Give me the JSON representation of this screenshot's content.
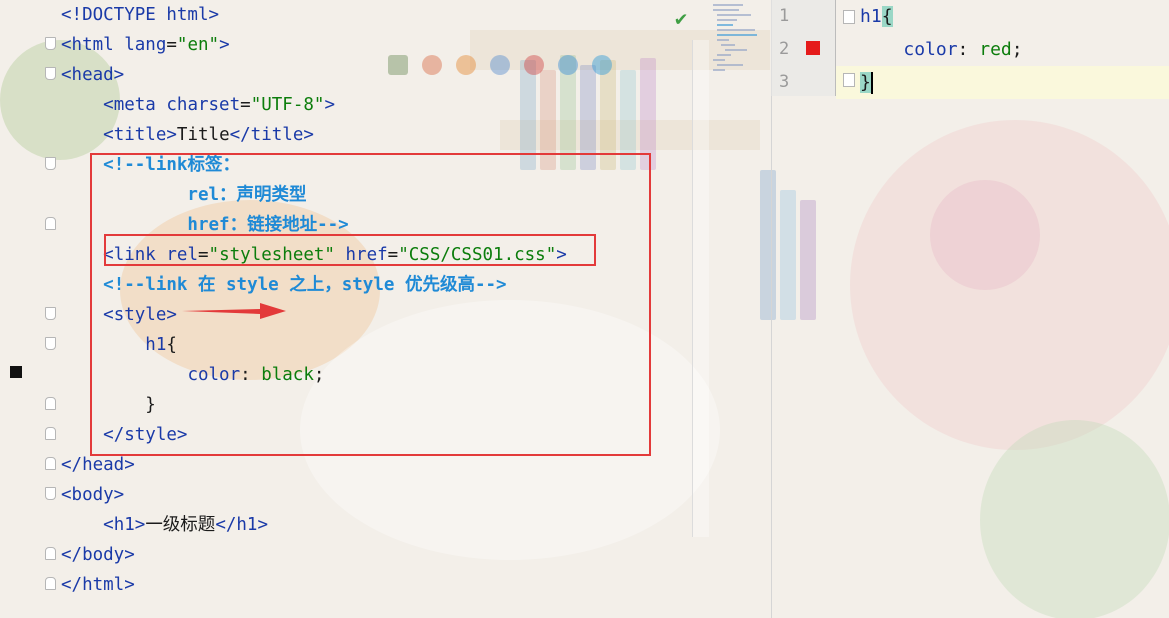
{
  "status": {
    "check_icon": "check-icon",
    "check_color": "#3f9e44"
  },
  "colors": {
    "tag": "#1a3aa8",
    "string": "#0c7d0c",
    "comment": "#1f8ad6",
    "annotation": "#e33a3a",
    "error_marker": "#e51b1b"
  },
  "left_editor": {
    "lines": [
      {
        "parts": [
          [
            "tag",
            "<!DOCTYPE html>"
          ]
        ]
      },
      {
        "parts": [
          [
            "tag",
            "<html "
          ],
          [
            "attr",
            "lang"
          ],
          [
            "punct",
            "="
          ],
          [
            "str",
            "\"en\""
          ],
          [
            "tag",
            ">"
          ]
        ]
      },
      {
        "parts": [
          [
            "tag",
            "<head>"
          ]
        ]
      },
      {
        "parts": [
          [
            "txt",
            "    "
          ],
          [
            "tag",
            "<meta "
          ],
          [
            "attr",
            "charset"
          ],
          [
            "punct",
            "="
          ],
          [
            "str",
            "\"UTF-8\""
          ],
          [
            "tag",
            ">"
          ]
        ]
      },
      {
        "parts": [
          [
            "txt",
            "    "
          ],
          [
            "tag",
            "<title>"
          ],
          [
            "txt",
            "Title"
          ],
          [
            "tag",
            "</title>"
          ]
        ]
      },
      {
        "parts": [
          [
            "txt",
            "    "
          ],
          [
            "cmt",
            "<!--link标签："
          ]
        ]
      },
      {
        "parts": [
          [
            "cmt",
            "            rel：声明类型"
          ]
        ]
      },
      {
        "parts": [
          [
            "cmt",
            "            href：链接地址-->"
          ]
        ]
      },
      {
        "parts": [
          [
            "txt",
            "    "
          ],
          [
            "tag",
            "<link "
          ],
          [
            "attr",
            "rel"
          ],
          [
            "punct",
            "="
          ],
          [
            "str",
            "\"stylesheet\""
          ],
          [
            "txt",
            " "
          ],
          [
            "attr",
            "href"
          ],
          [
            "punct",
            "="
          ],
          [
            "str",
            "\"CSS/CSS01.css\""
          ],
          [
            "tag",
            ">"
          ]
        ]
      },
      {
        "parts": [
          [
            "txt",
            "    "
          ],
          [
            "cmt",
            "<!--link 在 style 之上，style 优先级高-->"
          ]
        ]
      },
      {
        "parts": [
          [
            "txt",
            "    "
          ],
          [
            "tag",
            "<style>"
          ]
        ]
      },
      {
        "parts": [
          [
            "txt",
            "        "
          ],
          [
            "prop",
            "h1"
          ],
          [
            "punct",
            "{"
          ]
        ]
      },
      {
        "parts": [
          [
            "txt",
            "            "
          ],
          [
            "prop",
            "color"
          ],
          [
            "punct",
            ": "
          ],
          [
            "val",
            "black"
          ],
          [
            "punct",
            ";"
          ]
        ]
      },
      {
        "parts": [
          [
            "txt",
            "        "
          ],
          [
            "punct",
            "}"
          ]
        ]
      },
      {
        "parts": [
          [
            "txt",
            "    "
          ],
          [
            "tag",
            "</style>"
          ]
        ]
      },
      {
        "parts": [
          [
            "tag",
            "</head>"
          ]
        ]
      },
      {
        "parts": [
          [
            "tag",
            "<body>"
          ]
        ]
      },
      {
        "parts": [
          [
            "txt",
            "    "
          ],
          [
            "tag",
            "<h1>"
          ],
          [
            "txt",
            "一级标题"
          ],
          [
            "tag",
            "</h1>"
          ]
        ]
      },
      {
        "parts": [
          [
            "tag",
            "</body>"
          ]
        ]
      },
      {
        "parts": [
          [
            "tag",
            "</html>"
          ]
        ]
      }
    ]
  },
  "right_editor": {
    "line_numbers": [
      "1",
      "2",
      "3"
    ],
    "lines": [
      {
        "parts": [
          [
            "prop",
            "h1"
          ],
          [
            "brace",
            "{"
          ]
        ]
      },
      {
        "parts": [
          [
            "txt",
            "    "
          ],
          [
            "prop",
            "color"
          ],
          [
            "punct",
            ": "
          ],
          [
            "val",
            "red"
          ],
          [
            "punct",
            ";"
          ]
        ]
      },
      {
        "parts": [
          [
            "brace",
            "}"
          ],
          [
            "caret",
            ""
          ]
        ]
      }
    ]
  },
  "browser_icons": [
    "pycharm-icon",
    "chrome-icon",
    "firefox-icon",
    "safari-icon",
    "opera-icon",
    "ie-icon",
    "edge-icon"
  ]
}
